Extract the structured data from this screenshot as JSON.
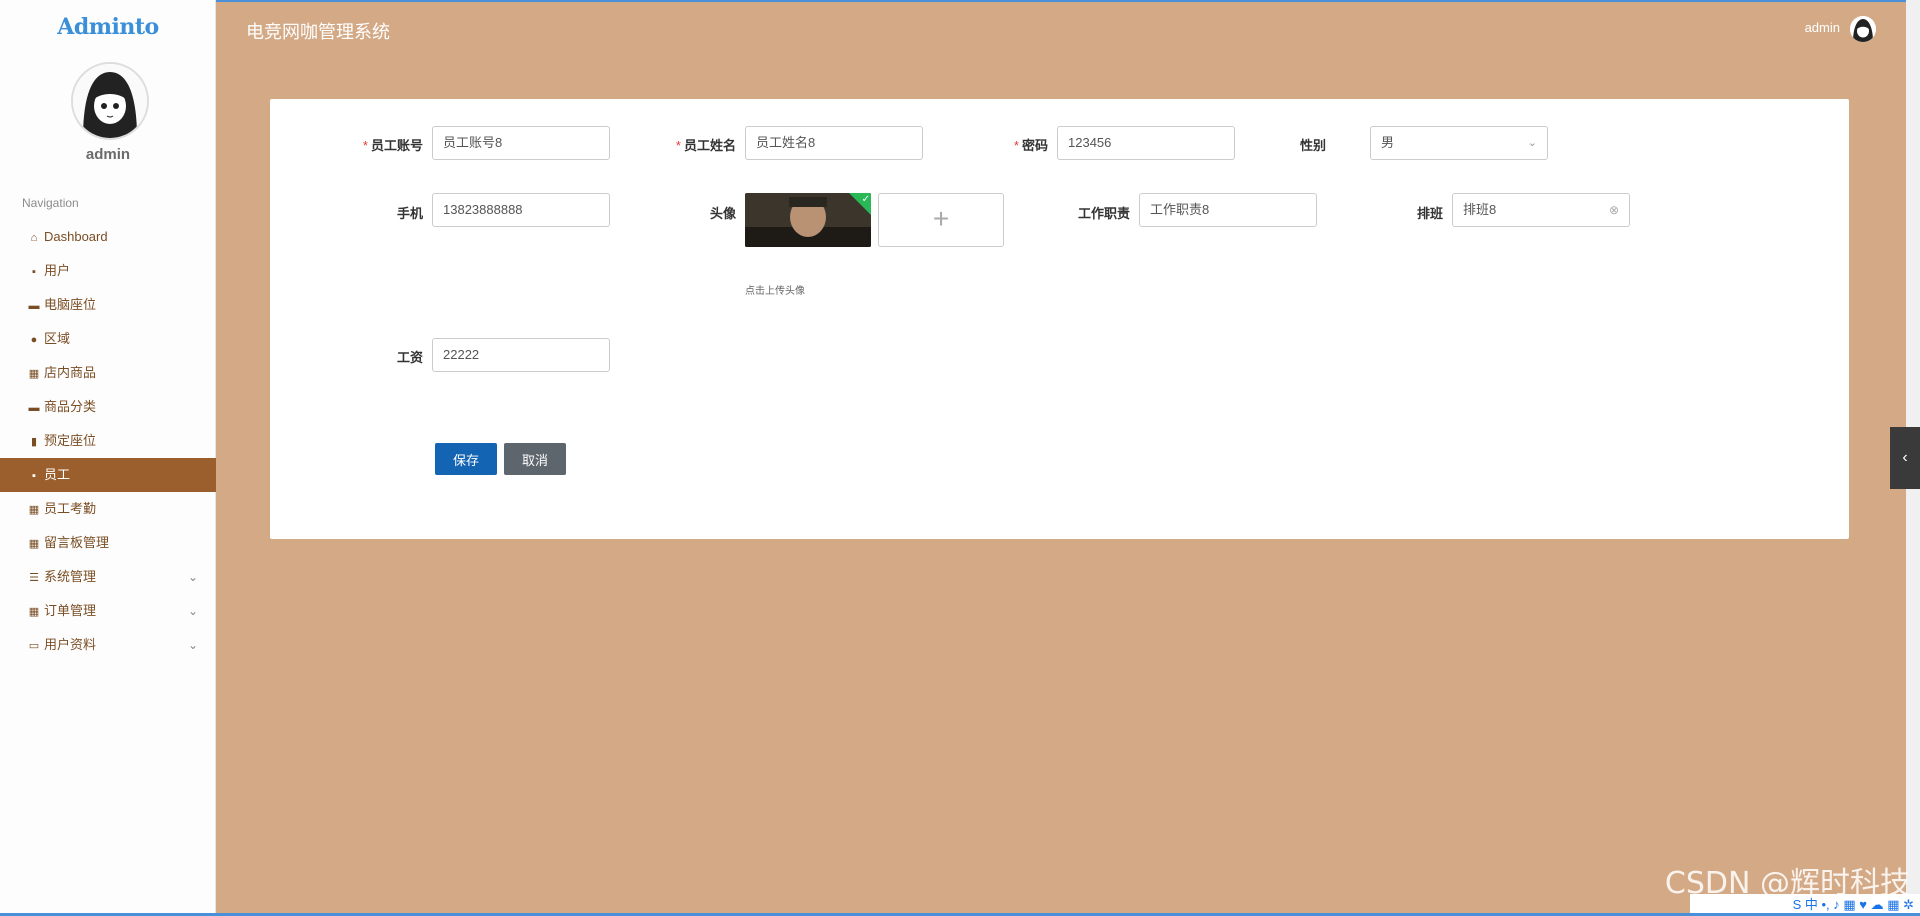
{
  "brand": {
    "logo": "Adminto"
  },
  "sidebar": {
    "username": "admin",
    "nav_title": "Navigation",
    "items": [
      {
        "label": "Dashboard",
        "icon": "home-icon",
        "glyph": "⌂"
      },
      {
        "label": "用户",
        "icon": "clipboard-icon",
        "glyph": "▪"
      },
      {
        "label": "电脑座位",
        "icon": "monitor-icon",
        "glyph": "▬"
      },
      {
        "label": "区域",
        "icon": "user-icon",
        "glyph": "●"
      },
      {
        "label": "店内商品",
        "icon": "grid-icon",
        "glyph": "▦"
      },
      {
        "label": "商品分类",
        "icon": "comment-icon",
        "glyph": "▬"
      },
      {
        "label": "预定座位",
        "icon": "bar-chart-icon",
        "glyph": "▮"
      },
      {
        "label": "员工",
        "icon": "clipboard-icon",
        "glyph": "▪"
      },
      {
        "label": "员工考勤",
        "icon": "grid-icon",
        "glyph": "▦"
      },
      {
        "label": "留言板管理",
        "icon": "grid-icon",
        "glyph": "▦"
      },
      {
        "label": "系统管理",
        "icon": "list-icon",
        "glyph": "☰"
      },
      {
        "label": "订单管理",
        "icon": "grid-icon",
        "glyph": "▦"
      },
      {
        "label": "用户资料",
        "icon": "id-card-icon",
        "glyph": "▭"
      }
    ],
    "active_index": 7
  },
  "header": {
    "title": "电竞网咖管理系统",
    "user": "admin"
  },
  "form": {
    "account": {
      "label": "员工账号",
      "value": "员工账号8"
    },
    "name": {
      "label": "员工姓名",
      "value": "员工姓名8"
    },
    "password": {
      "label": "密码",
      "value": "123456"
    },
    "gender": {
      "label": "性别",
      "value": "男"
    },
    "phone": {
      "label": "手机",
      "value": "13823888888"
    },
    "avatar": {
      "label": "头像",
      "hint": "点击上传头像",
      "add": "+"
    },
    "duty": {
      "label": "工作职责",
      "value": "工作职责8"
    },
    "schedule": {
      "label": "排班",
      "value": "排班8"
    },
    "salary": {
      "label": "工资",
      "value": "22222"
    },
    "save": "保存",
    "cancel": "取消"
  },
  "watermark": "CSDN @辉时科技",
  "tray": "S 中 •, ♪ ▦ ♥ ☁ ▦ ✲",
  "colors": {
    "accent": "#9b5f2d",
    "background": "#d4a986",
    "save": "#1464b4",
    "cancel": "#5e666d"
  }
}
